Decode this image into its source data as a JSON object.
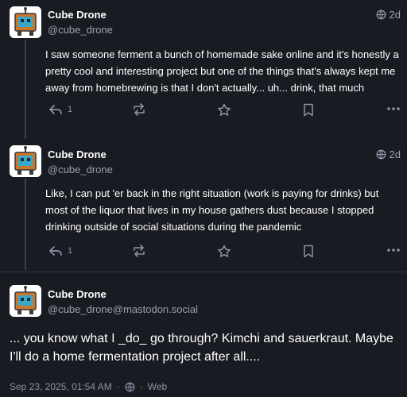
{
  "posts": [
    {
      "author": "Cube Drone",
      "handle": "@cube_drone",
      "time": "2d",
      "text": "I saw someone ferment a bunch of homemade sake online and it's honestly a pretty cool and interesting project but one of the things that's always kept me away from homebrewing is that I don't actually... uh... drink, that much",
      "reply_count": "1"
    },
    {
      "author": "Cube Drone",
      "handle": "@cube_drone",
      "time": "2d",
      "text": "Like, I can put 'er back in the right situation (work is paying for drinks) but most of the liquor that lives in my house gathers dust because I stopped drinking outside of social situations during the pandemic",
      "reply_count": "1"
    }
  ],
  "focused_post": {
    "author": "Cube Drone",
    "handle": "@cube_drone@mastodon.social",
    "text": "... you know what I _do_ go through? Kimchi and sauerkraut. Maybe I'll do a home fermentation project after all....",
    "timestamp": "Sep 23, 2025, 01:54 AM",
    "separator": "·",
    "visibility_icon": "globe-icon",
    "client": "Web"
  },
  "colors": {
    "background": "#191b22",
    "muted": "#9aa0b4",
    "thread_line": "#3b3f4f"
  }
}
